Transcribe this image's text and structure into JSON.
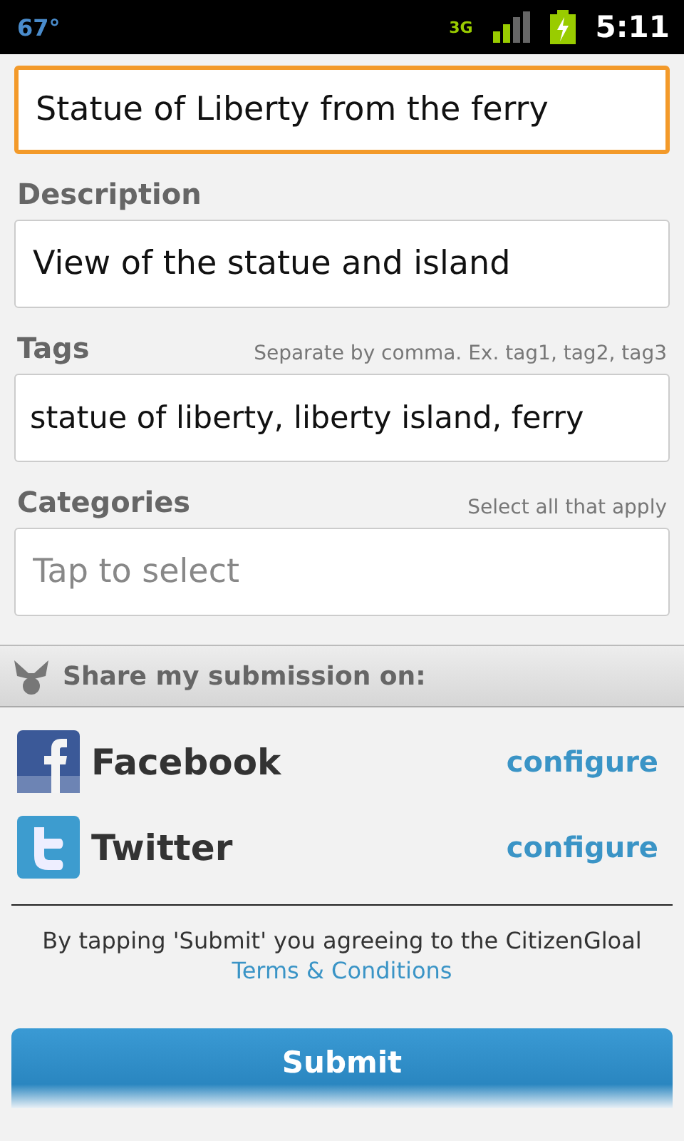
{
  "status_bar": {
    "temperature": "67°",
    "network": "3G",
    "time": "5:11"
  },
  "title_field": {
    "value": "Statue of Liberty from the ferry",
    "focused": true
  },
  "description": {
    "label": "Description",
    "value": "View of the statue and island"
  },
  "tags": {
    "label": "Tags",
    "hint": "Separate by comma. Ex. tag1, tag2, tag3",
    "value": "statue of liberty, liberty island, ferry"
  },
  "categories": {
    "label": "Categories",
    "hint": "Select all that apply",
    "placeholder": "Tap to select"
  },
  "share_header": "Share my submission on:",
  "services": [
    {
      "kind": "facebook",
      "name": "Facebook",
      "action": "configure"
    },
    {
      "kind": "twitter",
      "name": "Twitter",
      "action": "configure"
    }
  ],
  "agreement": {
    "text": "By tapping 'Submit' you agreeing to the CitizenGloal",
    "link": "Terms & Conditions"
  },
  "submit": "Submit"
}
